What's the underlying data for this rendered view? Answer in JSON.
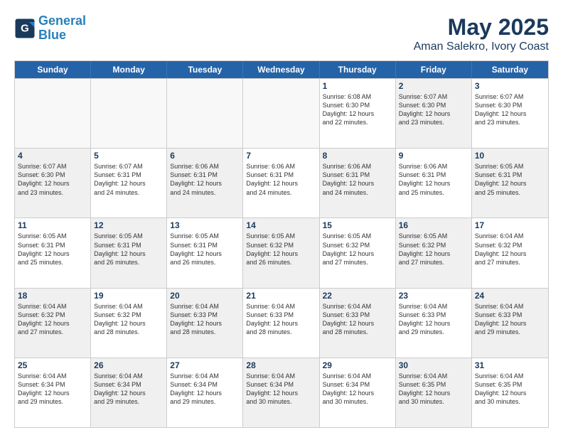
{
  "header": {
    "logo_line1": "General",
    "logo_line2": "Blue",
    "title": "May 2025",
    "subtitle": "Aman Salekro, Ivory Coast"
  },
  "weekdays": [
    "Sunday",
    "Monday",
    "Tuesday",
    "Wednesday",
    "Thursday",
    "Friday",
    "Saturday"
  ],
  "rows": [
    [
      {
        "day": "",
        "info": "",
        "empty": true
      },
      {
        "day": "",
        "info": "",
        "empty": true
      },
      {
        "day": "",
        "info": "",
        "empty": true
      },
      {
        "day": "",
        "info": "",
        "empty": true
      },
      {
        "day": "1",
        "info": "Sunrise: 6:08 AM\nSunset: 6:30 PM\nDaylight: 12 hours\nand 22 minutes."
      },
      {
        "day": "2",
        "info": "Sunrise: 6:07 AM\nSunset: 6:30 PM\nDaylight: 12 hours\nand 23 minutes.",
        "shaded": true
      },
      {
        "day": "3",
        "info": "Sunrise: 6:07 AM\nSunset: 6:30 PM\nDaylight: 12 hours\nand 23 minutes."
      }
    ],
    [
      {
        "day": "4",
        "info": "Sunrise: 6:07 AM\nSunset: 6:30 PM\nDaylight: 12 hours\nand 23 minutes.",
        "shaded": true
      },
      {
        "day": "5",
        "info": "Sunrise: 6:07 AM\nSunset: 6:31 PM\nDaylight: 12 hours\nand 24 minutes."
      },
      {
        "day": "6",
        "info": "Sunrise: 6:06 AM\nSunset: 6:31 PM\nDaylight: 12 hours\nand 24 minutes.",
        "shaded": true
      },
      {
        "day": "7",
        "info": "Sunrise: 6:06 AM\nSunset: 6:31 PM\nDaylight: 12 hours\nand 24 minutes."
      },
      {
        "day": "8",
        "info": "Sunrise: 6:06 AM\nSunset: 6:31 PM\nDaylight: 12 hours\nand 24 minutes.",
        "shaded": true
      },
      {
        "day": "9",
        "info": "Sunrise: 6:06 AM\nSunset: 6:31 PM\nDaylight: 12 hours\nand 25 minutes."
      },
      {
        "day": "10",
        "info": "Sunrise: 6:05 AM\nSunset: 6:31 PM\nDaylight: 12 hours\nand 25 minutes.",
        "shaded": true
      }
    ],
    [
      {
        "day": "11",
        "info": "Sunrise: 6:05 AM\nSunset: 6:31 PM\nDaylight: 12 hours\nand 25 minutes."
      },
      {
        "day": "12",
        "info": "Sunrise: 6:05 AM\nSunset: 6:31 PM\nDaylight: 12 hours\nand 26 minutes.",
        "shaded": true
      },
      {
        "day": "13",
        "info": "Sunrise: 6:05 AM\nSunset: 6:31 PM\nDaylight: 12 hours\nand 26 minutes."
      },
      {
        "day": "14",
        "info": "Sunrise: 6:05 AM\nSunset: 6:32 PM\nDaylight: 12 hours\nand 26 minutes.",
        "shaded": true
      },
      {
        "day": "15",
        "info": "Sunrise: 6:05 AM\nSunset: 6:32 PM\nDaylight: 12 hours\nand 27 minutes."
      },
      {
        "day": "16",
        "info": "Sunrise: 6:05 AM\nSunset: 6:32 PM\nDaylight: 12 hours\nand 27 minutes.",
        "shaded": true
      },
      {
        "day": "17",
        "info": "Sunrise: 6:04 AM\nSunset: 6:32 PM\nDaylight: 12 hours\nand 27 minutes."
      }
    ],
    [
      {
        "day": "18",
        "info": "Sunrise: 6:04 AM\nSunset: 6:32 PM\nDaylight: 12 hours\nand 27 minutes.",
        "shaded": true
      },
      {
        "day": "19",
        "info": "Sunrise: 6:04 AM\nSunset: 6:32 PM\nDaylight: 12 hours\nand 28 minutes."
      },
      {
        "day": "20",
        "info": "Sunrise: 6:04 AM\nSunset: 6:33 PM\nDaylight: 12 hours\nand 28 minutes.",
        "shaded": true
      },
      {
        "day": "21",
        "info": "Sunrise: 6:04 AM\nSunset: 6:33 PM\nDaylight: 12 hours\nand 28 minutes."
      },
      {
        "day": "22",
        "info": "Sunrise: 6:04 AM\nSunset: 6:33 PM\nDaylight: 12 hours\nand 28 minutes.",
        "shaded": true
      },
      {
        "day": "23",
        "info": "Sunrise: 6:04 AM\nSunset: 6:33 PM\nDaylight: 12 hours\nand 29 minutes."
      },
      {
        "day": "24",
        "info": "Sunrise: 6:04 AM\nSunset: 6:33 PM\nDaylight: 12 hours\nand 29 minutes.",
        "shaded": true
      }
    ],
    [
      {
        "day": "25",
        "info": "Sunrise: 6:04 AM\nSunset: 6:34 PM\nDaylight: 12 hours\nand 29 minutes."
      },
      {
        "day": "26",
        "info": "Sunrise: 6:04 AM\nSunset: 6:34 PM\nDaylight: 12 hours\nand 29 minutes.",
        "shaded": true
      },
      {
        "day": "27",
        "info": "Sunrise: 6:04 AM\nSunset: 6:34 PM\nDaylight: 12 hours\nand 29 minutes."
      },
      {
        "day": "28",
        "info": "Sunrise: 6:04 AM\nSunset: 6:34 PM\nDaylight: 12 hours\nand 30 minutes.",
        "shaded": true
      },
      {
        "day": "29",
        "info": "Sunrise: 6:04 AM\nSunset: 6:34 PM\nDaylight: 12 hours\nand 30 minutes."
      },
      {
        "day": "30",
        "info": "Sunrise: 6:04 AM\nSunset: 6:35 PM\nDaylight: 12 hours\nand 30 minutes.",
        "shaded": true
      },
      {
        "day": "31",
        "info": "Sunrise: 6:04 AM\nSunset: 6:35 PM\nDaylight: 12 hours\nand 30 minutes."
      }
    ]
  ]
}
